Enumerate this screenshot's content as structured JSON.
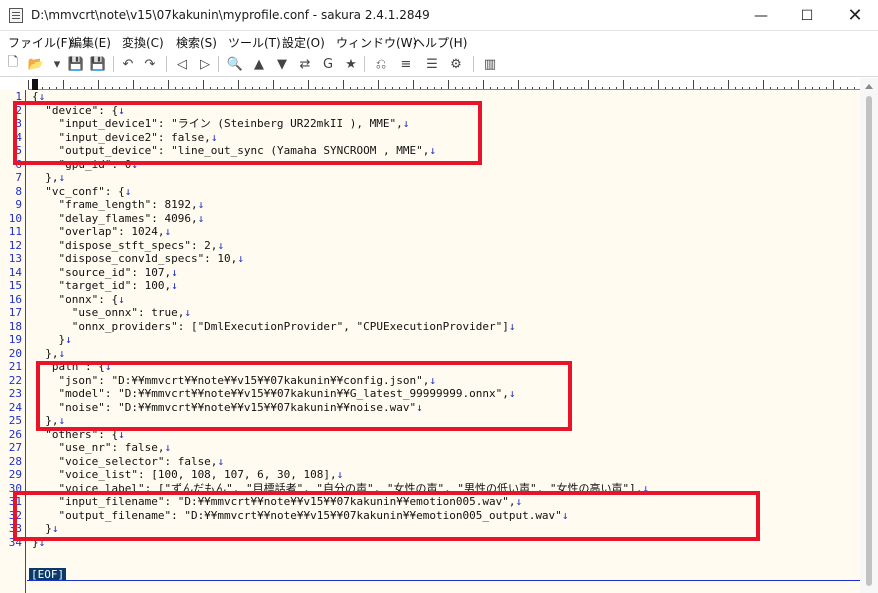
{
  "window": {
    "title": "D:\\mmvcrt\\note\\v15\\07kakunin\\myprofile.conf - sakura 2.4.1.2849",
    "minimize_glyph": "—",
    "maximize_glyph": "☐",
    "close_glyph": "✕"
  },
  "menu": [
    "ファイル(F)",
    "編集(E)",
    "変換(C)",
    "検索(S)",
    "ツール(T)",
    "設定(O)",
    "ウィンドウ(W)",
    "ヘルプ(H)"
  ],
  "toolbar": {
    "icons": [
      "new-file-icon",
      "open-file-icon",
      "dropdown-icon",
      "save-icon",
      "save-all-icon",
      "undo-icon",
      "redo-icon",
      "jump-back-icon",
      "jump-forward-icon",
      "find-icon",
      "find-prev-icon",
      "find-next-icon",
      "replace-icon",
      "grep-icon",
      "bookmark-icon",
      "compare-icon",
      "outline-icon",
      "function-list-icon",
      "settings-icon",
      "split-view-icon"
    ],
    "glyphs": [
      "🗋",
      "📂",
      "▾",
      "💾",
      "💾",
      "↶",
      "↷",
      "◁",
      "▷",
      "🔍",
      "▲",
      "▼",
      "⇄",
      "G",
      "★",
      "⎌",
      "≡",
      "☰",
      "⚙",
      "▥"
    ]
  },
  "editor": {
    "eol_mark": "↓",
    "eof_label": "[EOF]",
    "lines": [
      {
        "n": "1",
        "text": "{"
      },
      {
        "n": "2",
        "text": "  \"device\": {"
      },
      {
        "n": "3",
        "text": "    \"input_device1\": \"ライン (Steinberg UR22mkII ), MME\","
      },
      {
        "n": "4",
        "text": "    \"input_device2\": false,"
      },
      {
        "n": "5",
        "text": "    \"output_device\": \"line_out_sync (Yamaha SYNCROOM , MME\","
      },
      {
        "n": "6",
        "text": "    \"gpu_id\": 0"
      },
      {
        "n": "7",
        "text": "  },"
      },
      {
        "n": "8",
        "text": "  \"vc_conf\": {"
      },
      {
        "n": "9",
        "text": "    \"frame_length\": 8192,"
      },
      {
        "n": "10",
        "text": "    \"delay_flames\": 4096,"
      },
      {
        "n": "11",
        "text": "    \"overlap\": 1024,"
      },
      {
        "n": "12",
        "text": "    \"dispose_stft_specs\": 2,"
      },
      {
        "n": "13",
        "text": "    \"dispose_conv1d_specs\": 10,"
      },
      {
        "n": "14",
        "text": "    \"source_id\": 107,"
      },
      {
        "n": "15",
        "text": "    \"target_id\": 100,"
      },
      {
        "n": "16",
        "text": "    \"onnx\": {"
      },
      {
        "n": "17",
        "text": "      \"use_onnx\": true,"
      },
      {
        "n": "18",
        "text": "      \"onnx_providers\": [\"DmlExecutionProvider\", \"CPUExecutionProvider\"]"
      },
      {
        "n": "19",
        "text": "    }"
      },
      {
        "n": "20",
        "text": "  },"
      },
      {
        "n": "21",
        "text": "  \"path\": {"
      },
      {
        "n": "22",
        "text": "    \"json\": \"D:¥¥mmvcrt¥¥note¥¥v15¥¥07kakunin¥¥config.json\","
      },
      {
        "n": "23",
        "text": "    \"model\": \"D:¥¥mmvcrt¥¥note¥¥v15¥¥07kakunin¥¥G_latest_99999999.onnx\","
      },
      {
        "n": "24",
        "text": "    \"noise\": \"D:¥¥mmvcrt¥¥note¥¥v15¥¥07kakunin¥¥noise.wav\""
      },
      {
        "n": "25",
        "text": "  },"
      },
      {
        "n": "26",
        "text": "  \"others\": {"
      },
      {
        "n": "27",
        "text": "    \"use_nr\": false,"
      },
      {
        "n": "28",
        "text": "    \"voice_selector\": false,"
      },
      {
        "n": "29",
        "text": "    \"voice_list\": [100, 108, 107, 6, 30, 108],"
      },
      {
        "n": "30",
        "text": "    \"voice_label\": [\"ずんだもん\", \"目標話者\", \"自分の声\", \"女性の声\", \"男性の低い声\", \"女性の高い声\"],"
      },
      {
        "n": "31",
        "text": "    \"input_filename\": \"D:¥¥mmvcrt¥¥note¥¥v15¥¥07kakunin¥¥emotion005.wav\","
      },
      {
        "n": "32",
        "text": "    \"output_filename\": \"D:¥¥mmvcrt¥¥note¥¥v15¥¥07kakunin¥¥emotion005_output.wav\""
      },
      {
        "n": "33",
        "text": "  }"
      },
      {
        "n": "34",
        "text": "}"
      }
    ]
  },
  "colors": {
    "highlight": "#e8142a",
    "line_number": "#1e30c8",
    "editor_bg": "#fffbf0",
    "eof_bg": "#0a3a6b"
  }
}
